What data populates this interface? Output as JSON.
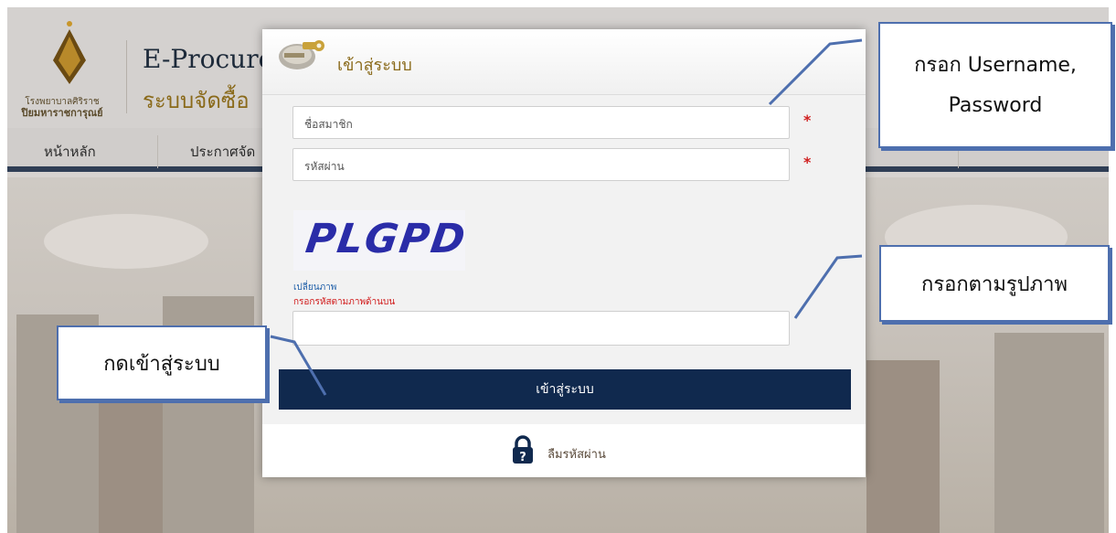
{
  "site": {
    "logo_line1": "โรงพยาบาลศิริราช",
    "logo_line2": "ปิยมหาราชการุณย์",
    "title": "E-Procure",
    "subtitle": "ระบบจัดซื้อ",
    "nav": [
      "หน้าหลัก",
      "ประกาศจัด"
    ]
  },
  "modal": {
    "title": "เข้าสู่ระบบ",
    "username_placeholder": "ชื่อสมาชิก",
    "password_placeholder": "รหัสผ่าน",
    "required_mark": "*",
    "captcha_text": "PLGPD",
    "change_image_link": "เปลี่ยนภาพ",
    "captcha_hint": "กรอกรหัสตามภาพด้านบน",
    "captcha_input_value": "",
    "login_button": "เข้าสู่ระบบ",
    "forgot_password": "ลืมรหัสผ่าน"
  },
  "callouts": {
    "credentials_line1": "กรอก Username,",
    "credentials_line2": "Password",
    "captcha": "กรอกตามรูปภาพ",
    "login": "กดเข้าสู่ระบบ"
  },
  "colors": {
    "login_button_bg": "#10294e",
    "title_gold": "#8a6a1a",
    "callout_border": "#4e6fae",
    "required_red": "#d02020"
  },
  "icons": [
    "key-icon",
    "lock-icon",
    "logo-emblem-icon"
  ]
}
